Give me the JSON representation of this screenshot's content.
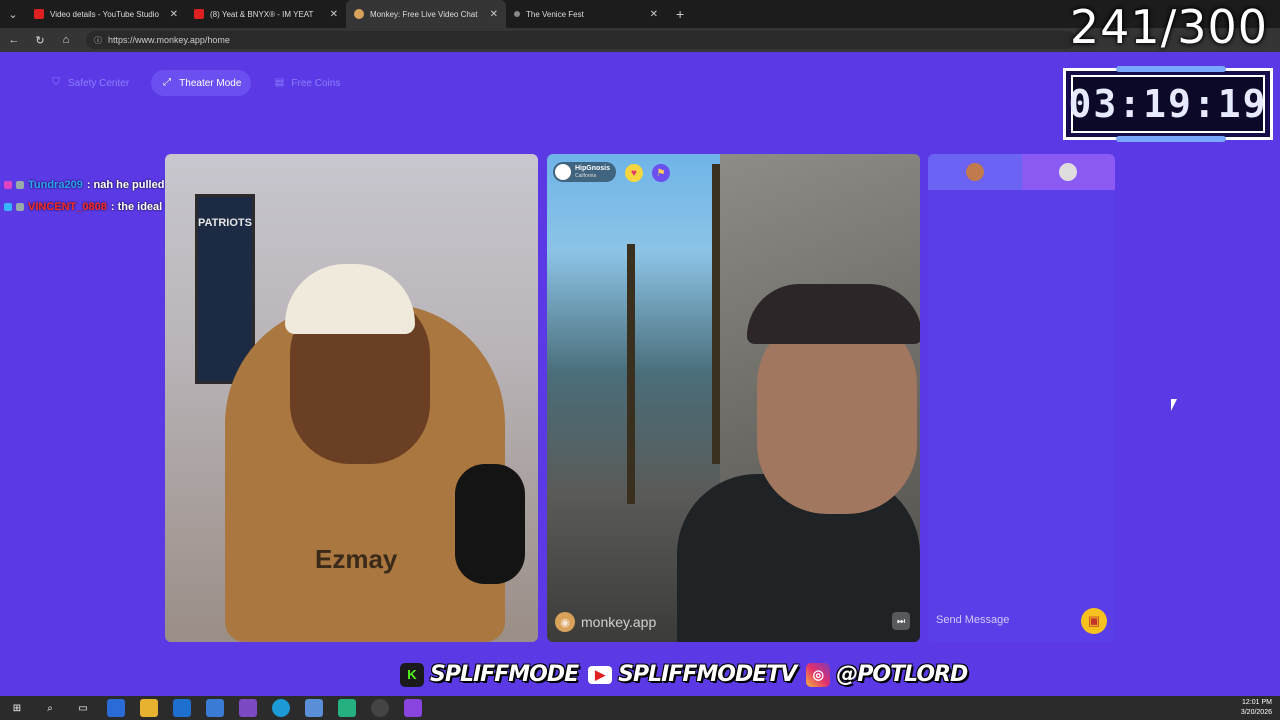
{
  "browser": {
    "tabs": [
      {
        "title": "Video details - YouTube Studio",
        "color": "#e02020",
        "active": false
      },
      {
        "title": "(8) Yeat & BNYX® - IM YEAT",
        "color": "#e02020",
        "active": false
      },
      {
        "title": "Monkey: Free Live Video Chat",
        "color": "#d9a25b",
        "active": true
      },
      {
        "title": "The Venice Fest",
        "color": "#888888",
        "active": false
      }
    ],
    "url": "https://www.monkey.app/home"
  },
  "overlay": {
    "counter": "241/300",
    "timer": "03:19:19"
  },
  "toolbar": {
    "safety_center": "Safety Center",
    "theater_mode": "Theater Mode",
    "free_coins": "Free Coins"
  },
  "chat": [
    {
      "user": "Tundra209",
      "user_color": "#2ea0ff",
      "text": ": nah he pulled out a doobie"
    },
    {
      "user": "VINCENT_0808",
      "user_color": "#ff2b2b",
      "text": ": the ideal trip for a man"
    }
  ],
  "video_left": {
    "poster": "PATRIOTS",
    "shirt": "Ezmay"
  },
  "video_right": {
    "user_name": "HipGnosis",
    "user_location": "California",
    "watermark": "monkey.app"
  },
  "chat_panel": {
    "placeholder": "Send Message"
  },
  "banner": {
    "kick": "SPLIFFMODE",
    "youtube": "SPLIFFMODETV",
    "instagram": "@POTLORD"
  },
  "taskbar": {
    "time": "12:01 PM",
    "date": "3/20/2026"
  },
  "colors": {
    "page_bg": "#5b3ae6",
    "accent": "#6b4ff0"
  }
}
